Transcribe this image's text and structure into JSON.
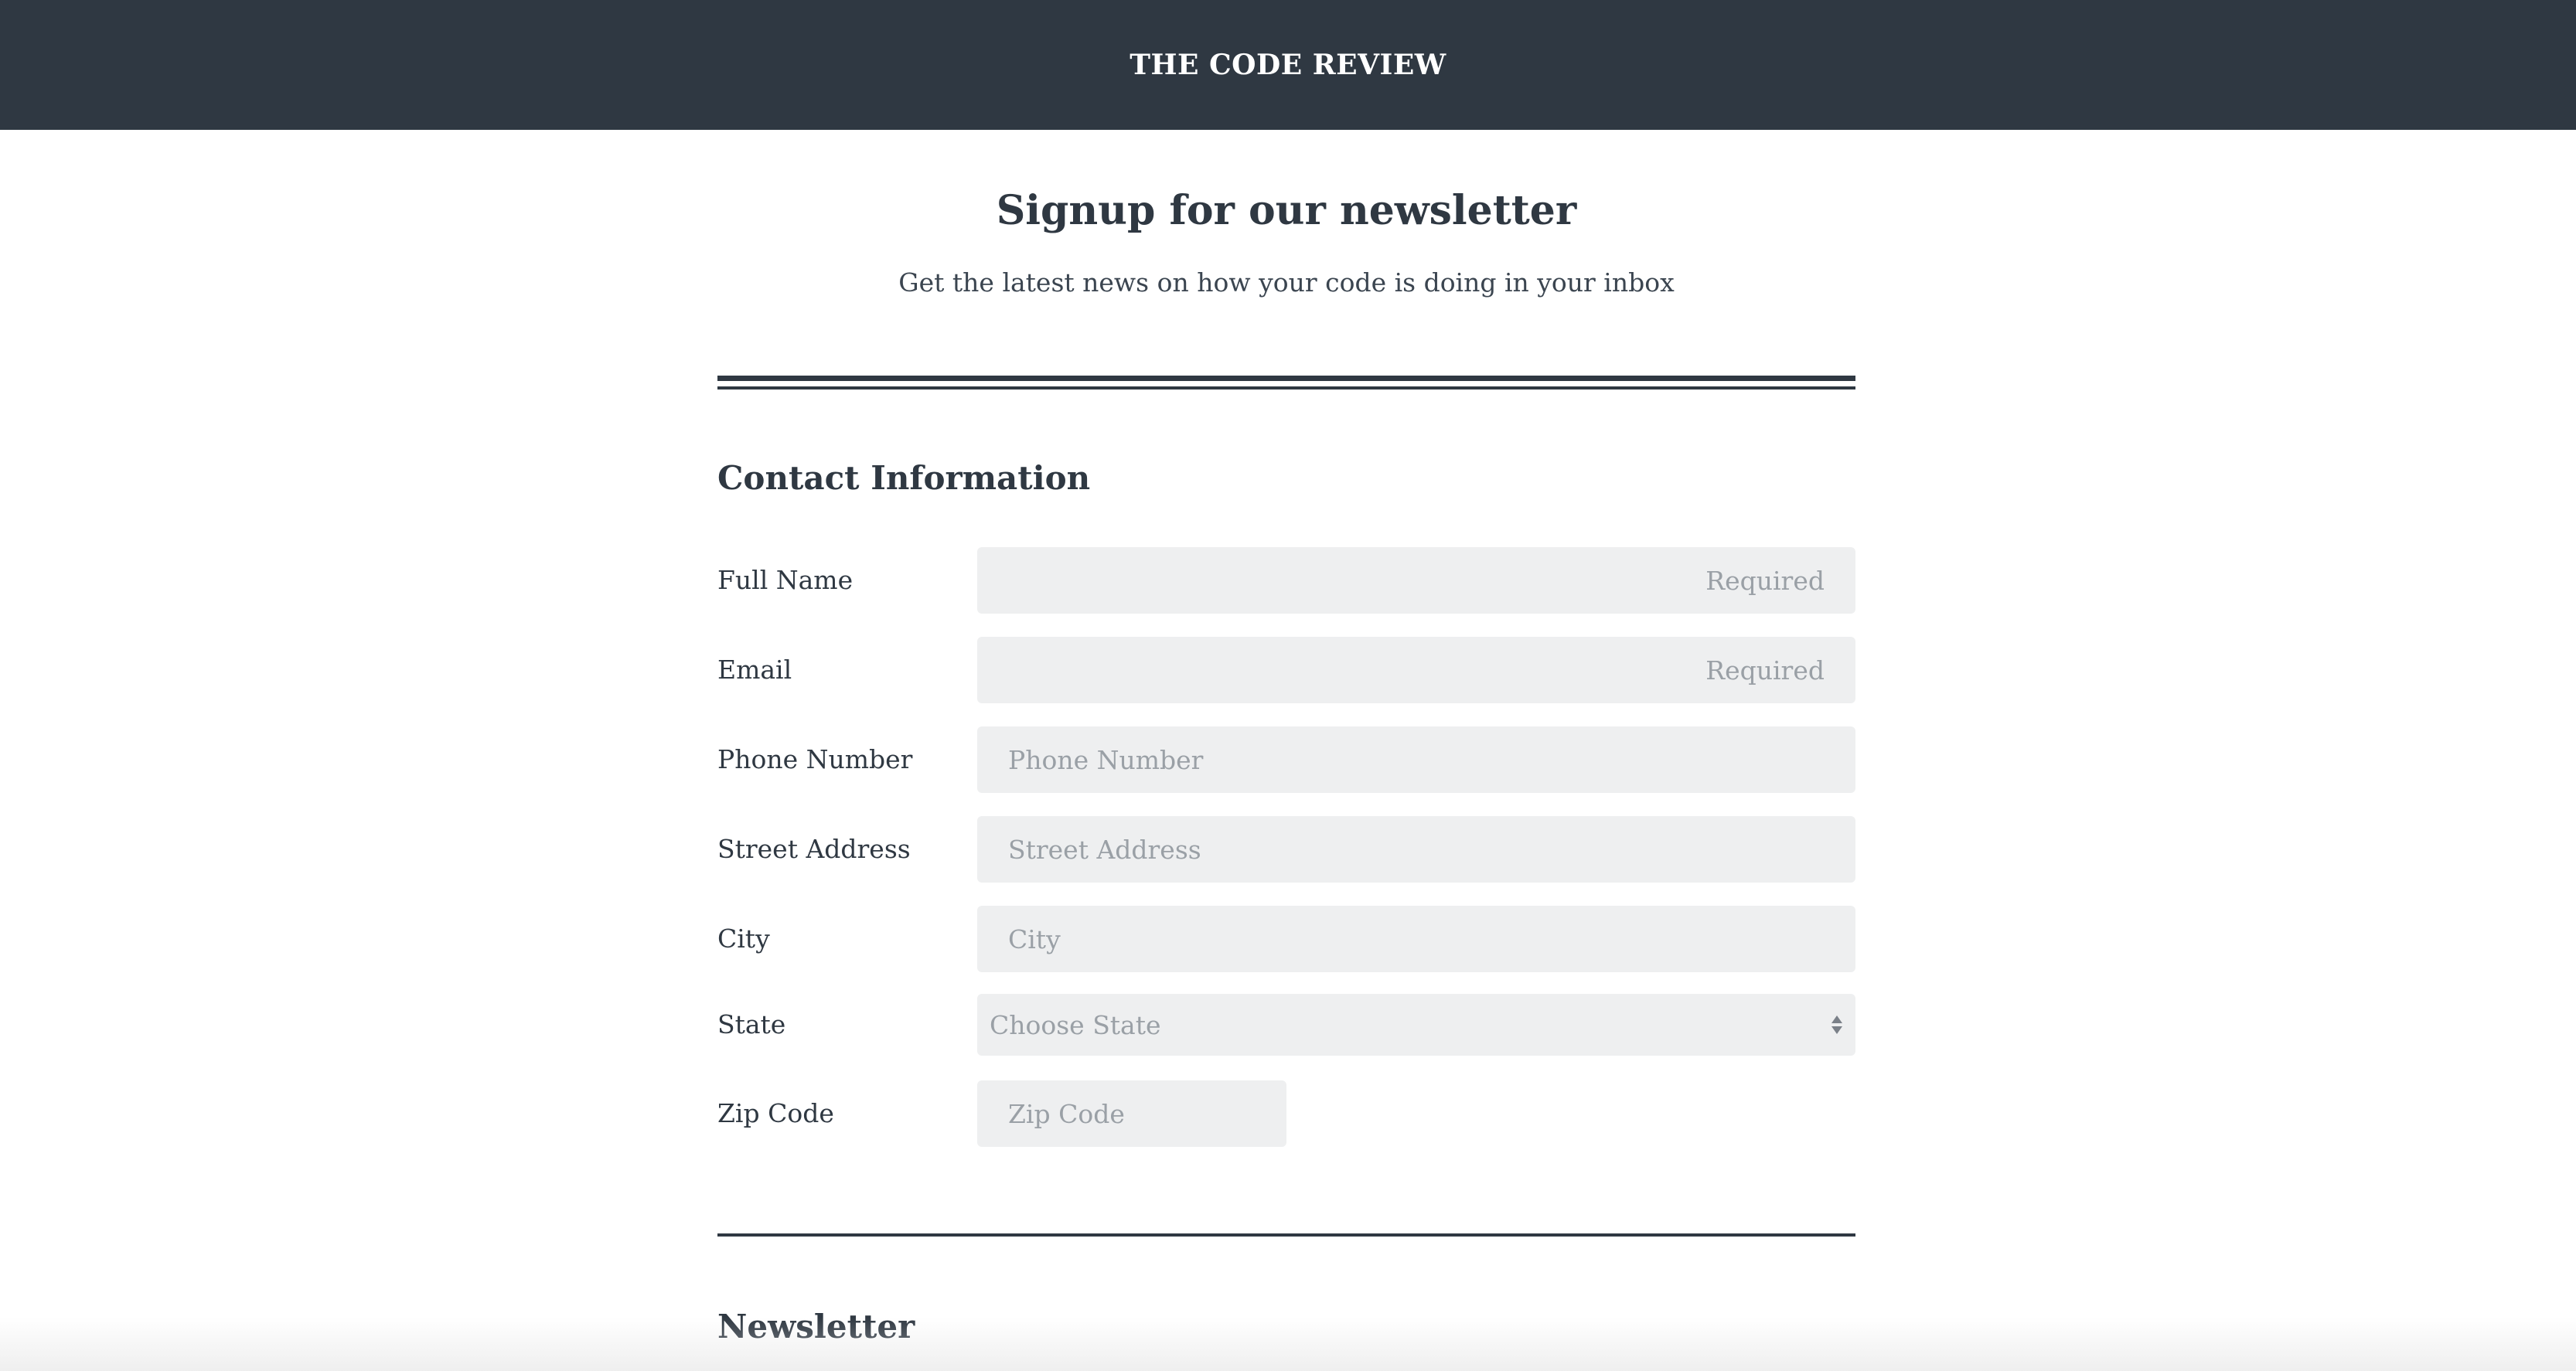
{
  "header": {
    "brand": "THE CODE REVIEW"
  },
  "intro": {
    "title": "Signup for our newsletter",
    "subtitle": "Get the latest news on how your code is doing in your inbox"
  },
  "contact": {
    "section_title": "Contact Information",
    "fields": [
      {
        "label": "Full Name",
        "placeholder": "Required",
        "value": ""
      },
      {
        "label": "Email",
        "placeholder": "Required",
        "value": ""
      },
      {
        "label": "Phone Number",
        "placeholder": "Phone Number",
        "value": ""
      },
      {
        "label": "Street Address",
        "placeholder": "Street Address",
        "value": ""
      },
      {
        "label": "City",
        "placeholder": "City",
        "value": ""
      },
      {
        "label": "State",
        "selected": "Choose State"
      },
      {
        "label": "Zip Code",
        "placeholder": "Zip Code",
        "value": ""
      }
    ]
  },
  "newsletter": {
    "section_title": "Newsletter"
  },
  "icons": {
    "state_select": "select-updown-arrows-icon"
  },
  "colors": {
    "header_bg": "#2f3842",
    "text": "#2f3842",
    "field_bg": "#eeeff0",
    "placeholder": "#9aa0a6"
  }
}
